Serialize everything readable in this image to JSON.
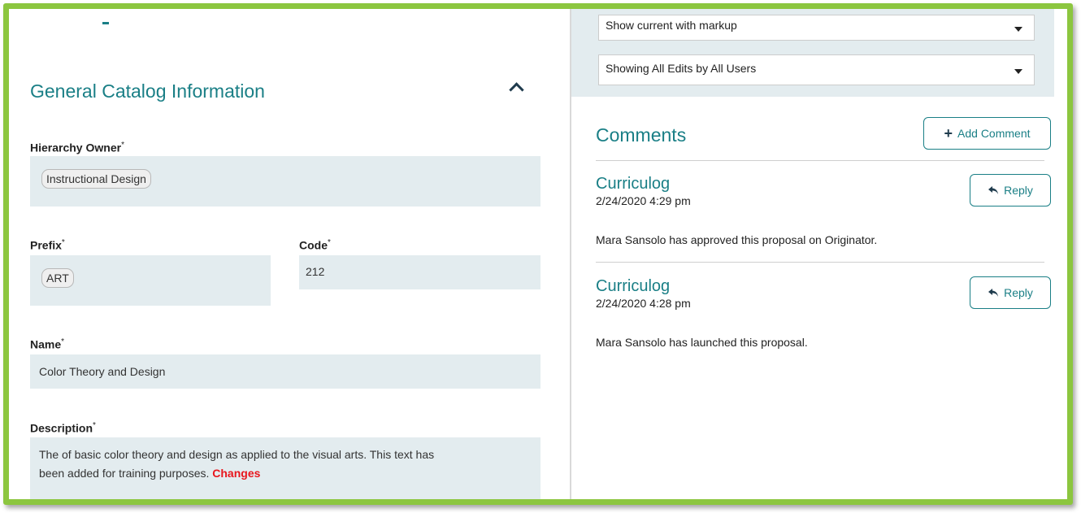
{
  "left": {
    "section_title": "General Catalog Information",
    "hierarchy_owner": {
      "label": "Hierarchy Owner",
      "value": "Instructional Design"
    },
    "prefix": {
      "label": "Prefix",
      "value": "ART"
    },
    "code": {
      "label": "Code",
      "value": "212"
    },
    "name": {
      "label": "Name",
      "value": "Color Theory and Design"
    },
    "description": {
      "label": "Description",
      "value_line1": "The of basic color theory and design as applied to the visual arts. This text has",
      "value_line2": "been added for training purposes.",
      "changes": "Changes"
    },
    "required_marker": "*"
  },
  "right": {
    "view_select": "Show current with markup",
    "edits_select": "Showing All Edits by All Users",
    "comments_title": "Comments",
    "add_comment_label": "Add Comment",
    "comments": [
      {
        "author": "Curriculog",
        "date": "2/24/2020 4:29 pm",
        "body": "Mara Sansolo has approved this proposal on Originator.",
        "reply_label": "Reply"
      },
      {
        "author": "Curriculog",
        "date": "2/24/2020 4:28 pm",
        "body": "Mara Sansolo has launched this proposal.",
        "reply_label": "Reply"
      }
    ]
  },
  "colors": {
    "accent": "#1a7f86",
    "frame": "#8cc63f",
    "field_bg": "#e3ecef",
    "changes": "#e8161d"
  }
}
